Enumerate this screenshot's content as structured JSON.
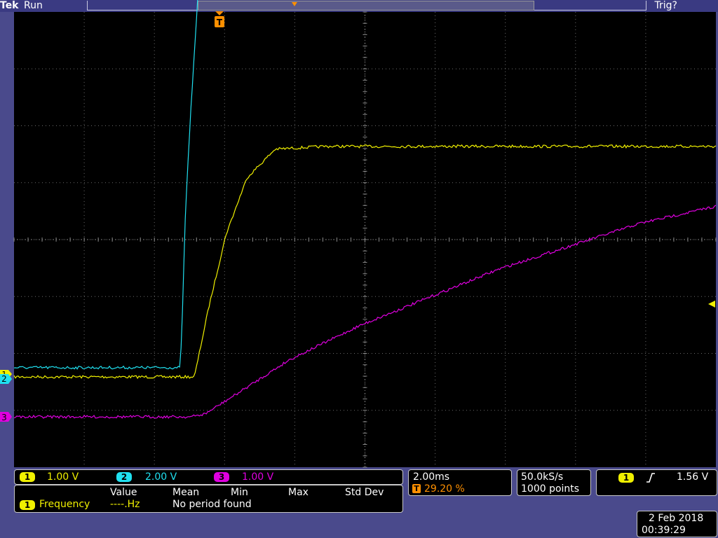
{
  "header": {
    "brand": "Tek",
    "status": "Run",
    "trigger_status": "Trig?"
  },
  "markers": {
    "trigger_position_label": "T",
    "channel1_ground": "1",
    "channel2_ground": "2",
    "channel3_ground": "3"
  },
  "channels": [
    {
      "id": "1",
      "scale": "1.00 V",
      "color": "#f0f000"
    },
    {
      "id": "2",
      "scale": "2.00 V",
      "color": "#20e0f0"
    },
    {
      "id": "3",
      "scale": "1.00 V",
      "color": "#e000e0"
    }
  ],
  "timebase": {
    "scale": "2.00ms",
    "trigger_badge": "T",
    "trigger_position": "29.20 %"
  },
  "acquisition": {
    "sample_rate": "50.0kS/s",
    "record_length": "1000 points"
  },
  "trigger": {
    "source": "1",
    "slope_icon": "rising-edge-icon",
    "level": "1.56 V"
  },
  "measurement": {
    "headers": {
      "value": "Value",
      "mean": "Mean",
      "min": "Min",
      "max": "Max",
      "std_dev": "Std Dev"
    },
    "source": "1",
    "name": "Frequency",
    "value": "----.Hz",
    "message": "No period found"
  },
  "datetime": {
    "date": "2 Feb  2018",
    "time": "00:39:29"
  },
  "chart_data": {
    "type": "line",
    "xlabel": "",
    "ylabel": "",
    "x_unit": "ms",
    "x_range": [
      -5.84,
      14.16
    ],
    "time_per_div": 2.0,
    "y_divisions": 8,
    "grid": true,
    "series": [
      {
        "name": "1",
        "color": "#f0f000",
        "volts_per_div": 1.0,
        "points": [
          [
            -5.84,
            0.0
          ],
          [
            -0.7,
            0.0
          ],
          [
            -0.6,
            0.3
          ],
          [
            -0.3,
            1.2
          ],
          [
            0.2,
            2.5
          ],
          [
            0.8,
            3.5
          ],
          [
            1.6,
            4.0
          ],
          [
            3.0,
            4.05
          ],
          [
            8.0,
            4.05
          ],
          [
            14.16,
            4.05
          ]
        ]
      },
      {
        "name": "2",
        "color": "#20e0f0",
        "volts_per_div": 2.0,
        "points": [
          [
            -5.84,
            0.4
          ],
          [
            -1.1,
            0.4
          ],
          [
            -1.05,
            2.0
          ],
          [
            -0.95,
            6.0
          ],
          [
            -0.8,
            9.5
          ],
          [
            -0.6,
            13.5
          ],
          [
            -0.4,
            14.0
          ],
          [
            0.3,
            14.2
          ],
          [
            3.0,
            14.0
          ],
          [
            14.16,
            14.1
          ]
        ]
      },
      {
        "name": "3",
        "color": "#e000e0",
        "volts_per_div": 1.0,
        "points": [
          [
            -5.84,
            0.0
          ],
          [
            -0.8,
            0.0
          ],
          [
            -0.4,
            0.05
          ],
          [
            0.5,
            0.4
          ],
          [
            2.0,
            1.0
          ],
          [
            4.0,
            1.6
          ],
          [
            6.0,
            2.1
          ],
          [
            8.0,
            2.6
          ],
          [
            10.0,
            3.0
          ],
          [
            12.0,
            3.4
          ],
          [
            14.16,
            3.7
          ]
        ]
      }
    ]
  }
}
